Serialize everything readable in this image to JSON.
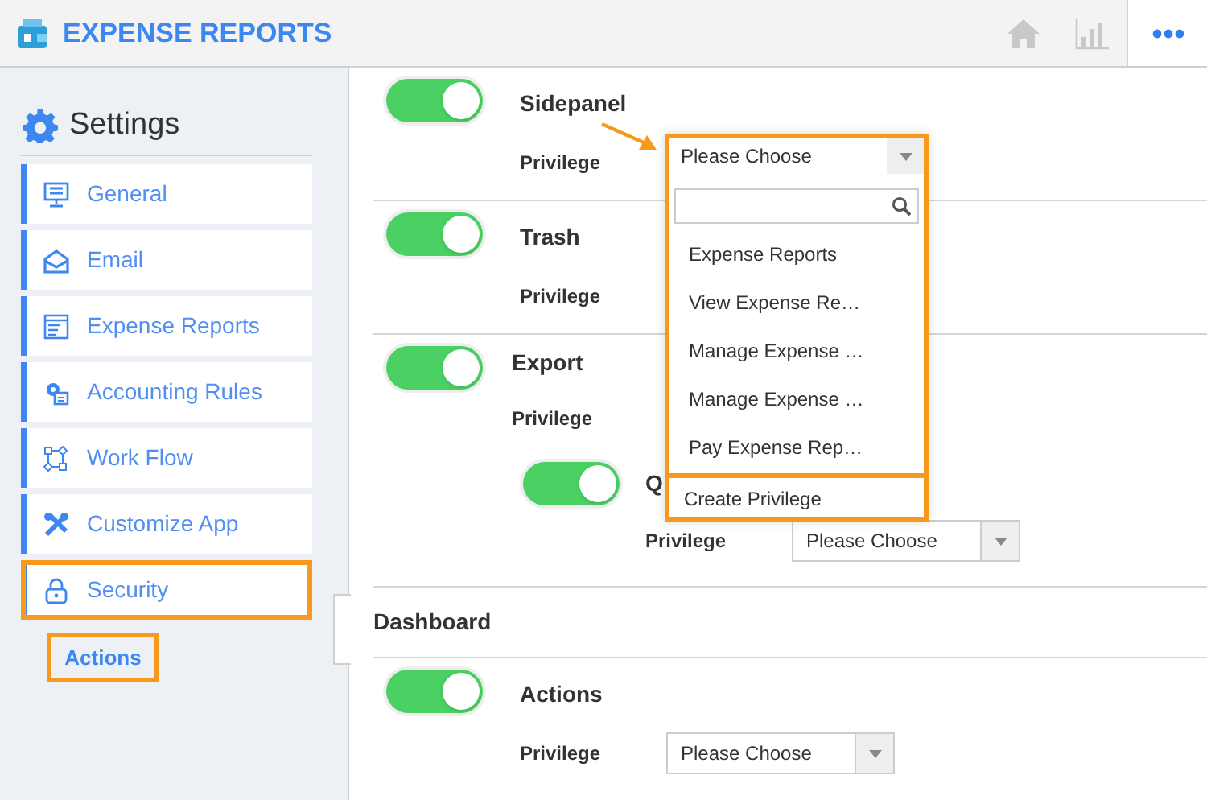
{
  "app": {
    "title": "EXPENSE REPORTS"
  },
  "toolbar": [
    {
      "kind": "home",
      "selected": false
    },
    {
      "kind": "chart",
      "selected": false
    },
    {
      "kind": "more",
      "selected": true
    }
  ],
  "sidebar": {
    "title": "Settings",
    "items": [
      {
        "label": "General",
        "highlighted": false
      },
      {
        "label": "Email",
        "highlighted": false
      },
      {
        "label": "Expense Reports",
        "highlighted": false
      },
      {
        "label": "Accounting Rules",
        "highlighted": false
      },
      {
        "label": "Work Flow",
        "highlighted": false
      },
      {
        "label": "Customize App",
        "highlighted": false
      },
      {
        "label": "Security",
        "highlighted": true,
        "children": [
          {
            "label": "Actions",
            "selected": true,
            "highlighted": true
          }
        ]
      }
    ]
  },
  "sections": [
    {
      "kind": "setting",
      "title": "Sidepanel",
      "on": true,
      "privilege_label": "Privilege"
    },
    {
      "kind": "setting",
      "title": "Trash",
      "on": true,
      "privilege_label": "Privilege"
    },
    {
      "kind": "setting",
      "title": "Export",
      "on": true,
      "privilege_label": "Privilege",
      "children": [
        {
          "kind": "setting",
          "title": "Q",
          "on": true,
          "privilege_label": "Privilege",
          "select": {
            "value": "Please Choose"
          }
        }
      ]
    },
    {
      "kind": "heading",
      "title": "Dashboard"
    },
    {
      "kind": "setting",
      "title": "Actions",
      "on": true,
      "privilege_label": "Privilege",
      "select": {
        "value": "Please Choose"
      }
    }
  ],
  "dropdown": {
    "highlighted": true,
    "value": "Please Choose",
    "options": [
      "Expense Reports",
      "View Expense Re…",
      "Manage Expense …",
      "Manage Expense …",
      "Pay Expense Rep…"
    ],
    "footer": "Create Privilege"
  }
}
